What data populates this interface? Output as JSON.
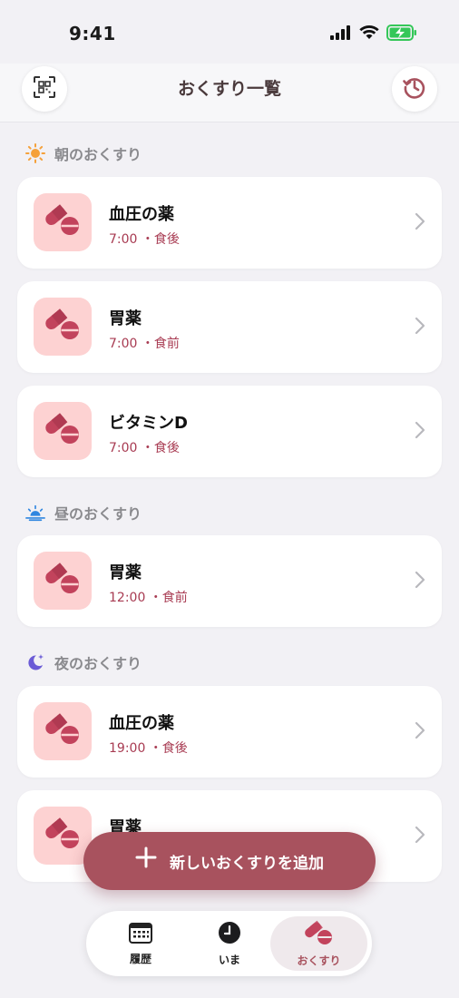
{
  "status_bar": {
    "time": "9:41"
  },
  "header": {
    "title": "おくすり一覧"
  },
  "sections": [
    {
      "title": "朝のおくすり",
      "icon": "sun-icon",
      "items": [
        {
          "name": "血圧の薬",
          "time": "7:00 ・食後"
        },
        {
          "name": "胃薬",
          "time": "7:00 ・食前"
        },
        {
          "name": "ビタミンD",
          "time": "7:00 ・食後"
        }
      ]
    },
    {
      "title": "昼のおくすり",
      "icon": "sunrise-icon",
      "items": [
        {
          "name": "胃薬",
          "time": "12:00 ・食前"
        }
      ]
    },
    {
      "title": "夜のおくすり",
      "icon": "moon-icon",
      "items": [
        {
          "name": "血圧の薬",
          "time": "19:00 ・食後"
        },
        {
          "name": "胃薬",
          "time": ""
        }
      ]
    }
  ],
  "fab": {
    "label": "新しいおくすりを追加"
  },
  "tabs": [
    {
      "label": "履歴",
      "icon": "calendar-icon"
    },
    {
      "label": "いま",
      "icon": "clock-icon"
    },
    {
      "label": "おくすり",
      "icon": "pill-icon"
    }
  ],
  "colors": {
    "accent": "#a8525e",
    "time_text": "#a83b52",
    "pill_bg": "#fdd2d2",
    "pill": "#c2435c"
  }
}
